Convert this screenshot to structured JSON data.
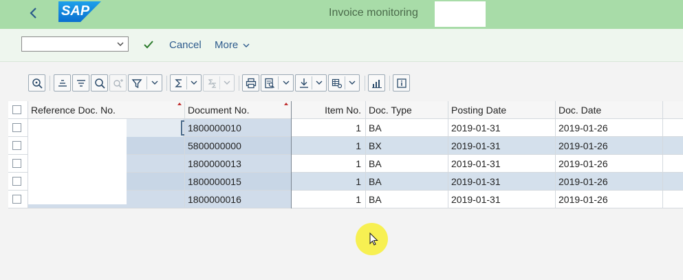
{
  "header": {
    "title": "Invoice monitoring",
    "logo_text": "SAP",
    "back_icon": "chevron-left-icon",
    "accent_color": "#a8dca8",
    "brand_color": "#0a6fd0"
  },
  "commandbar": {
    "variant_select_value": "",
    "confirm_icon": "checkmark-icon",
    "cancel_label": "Cancel",
    "more_label": "More"
  },
  "toolbar": {
    "icons": [
      "zoom-detail-icon",
      "sort-ascending-icon",
      "sort-descending-icon",
      "find-icon",
      "find-next-icon",
      "filter-icon",
      "sum-icon",
      "subtotal-icon",
      "print-icon",
      "print-preview-icon",
      "export-icon",
      "layout-icon",
      "chart-icon",
      "info-icon"
    ]
  },
  "table": {
    "columns": [
      "Reference Doc. No.",
      "Document No.",
      "Item No.",
      "Doc. Type",
      "Posting Date",
      "Doc. Date"
    ],
    "rows": [
      {
        "ref": "",
        "doc": "1800000010",
        "item": "1",
        "type": "BA",
        "posting": "2019-01-31",
        "docdate": "2019-01-26"
      },
      {
        "ref": "",
        "doc": "5800000000",
        "item": "1",
        "type": "BX",
        "posting": "2019-01-31",
        "docdate": "2019-01-26"
      },
      {
        "ref": "",
        "doc": "1800000013",
        "item": "1",
        "type": "BA",
        "posting": "2019-01-31",
        "docdate": "2019-01-26"
      },
      {
        "ref": "",
        "doc": "1800000015",
        "item": "1",
        "type": "BA",
        "posting": "2019-01-31",
        "docdate": "2019-01-26"
      },
      {
        "ref": "",
        "doc": "1800000016",
        "item": "1",
        "type": "BA",
        "posting": "2019-01-31",
        "docdate": "2019-01-26"
      }
    ]
  }
}
